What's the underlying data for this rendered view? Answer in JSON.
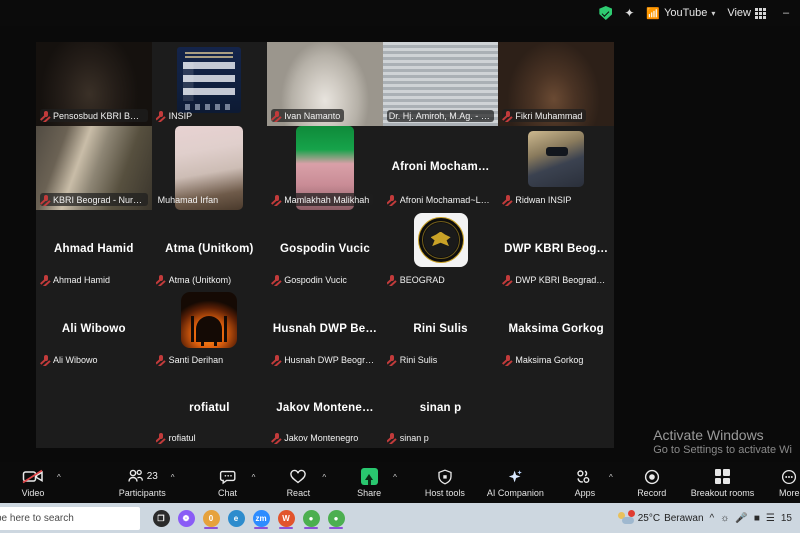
{
  "topbar": {
    "security_icon": "shield-check-icon",
    "sparkle_icon": "sparkle-icon",
    "youtube_icon": "broadcast-icon",
    "youtube_label": "YouTube",
    "chevron": "⌄",
    "view_label": "View",
    "view_icon": "grid-icon",
    "minimize_label": "–"
  },
  "gallery": {
    "rows": [
      {
        "tiles": [
          {
            "display_name": "",
            "label": "Pensosbud KBRI Beograd …",
            "muted": true,
            "kind": "video",
            "video": "v-pensos",
            "active": false
          },
          {
            "display_name": "",
            "label": "INSIP",
            "muted": true,
            "kind": "poster",
            "active": false
          },
          {
            "display_name": "",
            "label": "Ivan Namanto",
            "muted": true,
            "kind": "video",
            "video": "v-ivan",
            "active": false
          },
          {
            "display_name": "",
            "label": "Dr. Hj. Amiroh, M.Ag. - Rektor IN…",
            "muted": false,
            "kind": "video",
            "video": "v-amiroh",
            "active": true
          },
          {
            "display_name": "",
            "label": "Fikri Muhammad",
            "muted": true,
            "kind": "video",
            "video": "v-fikri",
            "active": false
          }
        ]
      },
      {
        "tiles": [
          {
            "display_name": "",
            "label": "KBRI Beograd - Nurus Syamsi",
            "muted": true,
            "kind": "video",
            "video": "v-kbri",
            "active": false
          },
          {
            "display_name": "",
            "label": "Muhamad Irfan",
            "muted": false,
            "kind": "inset-photo",
            "active": false
          },
          {
            "display_name": "",
            "label": "Mamlakhah Malikhah",
            "muted": true,
            "kind": "inset-video",
            "active": false
          },
          {
            "display_name": "Afroni  Mocham…",
            "label": "Afroni Mochamad~LPPM INSIP",
            "muted": true,
            "kind": "name",
            "active": false
          },
          {
            "display_name": "",
            "label": "Ridwan INSIP",
            "muted": true,
            "kind": "inset-avatar",
            "active": false
          }
        ]
      },
      {
        "tiles": [
          {
            "display_name": "Ahmad Hamid",
            "label": "Ahmad Hamid",
            "muted": true,
            "kind": "name",
            "active": false
          },
          {
            "display_name": "Atma (Unitkom)",
            "label": "Atma (Unitkom)",
            "muted": true,
            "kind": "name",
            "active": false
          },
          {
            "display_name": "Gospodin Vucic",
            "label": "Gospodin Vucic",
            "muted": true,
            "kind": "name",
            "active": false
          },
          {
            "display_name": "",
            "label": "BEOGRAD",
            "muted": true,
            "kind": "logo",
            "active": false
          },
          {
            "display_name": "DWP KBRI Beog…",
            "label": "DWP KBRI Beograd-Anggi Wd",
            "muted": true,
            "kind": "name",
            "active": false
          }
        ]
      },
      {
        "tiles": [
          {
            "display_name": "Ali Wibowo",
            "label": "Ali Wibowo",
            "muted": true,
            "kind": "name",
            "active": false
          },
          {
            "display_name": "",
            "label": "Santi Derihan",
            "muted": true,
            "kind": "mosque",
            "active": false
          },
          {
            "display_name": "Husnah  DWP Be…",
            "label": "Husnah DWP Beograd",
            "muted": true,
            "kind": "name",
            "active": false
          },
          {
            "display_name": "Rini Sulis",
            "label": "Rini Sulis",
            "muted": true,
            "kind": "name",
            "active": false
          },
          {
            "display_name": "Maksima Gorkog",
            "label": "Maksima Gorkog",
            "muted": true,
            "kind": "name",
            "active": false
          }
        ]
      },
      {
        "tiles": [
          {
            "display_name": "",
            "label": "",
            "muted": false,
            "kind": "empty",
            "active": false
          },
          {
            "display_name": "rofiatul",
            "label": "rofiatul",
            "muted": true,
            "kind": "name",
            "active": false
          },
          {
            "display_name": "Jakov  Montene…",
            "label": "Jakov Montenegro",
            "muted": true,
            "kind": "name",
            "active": false
          },
          {
            "display_name": "sinan p",
            "label": "sinan p",
            "muted": true,
            "kind": "name",
            "active": false
          },
          {
            "display_name": "",
            "label": "",
            "muted": false,
            "kind": "empty",
            "active": false
          }
        ]
      }
    ]
  },
  "watermark": {
    "line1": "Activate Windows",
    "line2": "Go to Settings to activate Wi"
  },
  "toolbar": {
    "video": {
      "label": "Video",
      "icon": "video-off-icon",
      "has_arrow": true
    },
    "participants": {
      "label": "Participants",
      "icon": "participants-icon",
      "count": "23",
      "has_arrow": true
    },
    "chat": {
      "label": "Chat",
      "icon": "chat-icon",
      "has_arrow": true
    },
    "react": {
      "label": "React",
      "icon": "heart-icon",
      "has_arrow": true
    },
    "share": {
      "label": "Share",
      "icon": "share-screen-icon",
      "has_arrow": true
    },
    "host_tools": {
      "label": "Host tools",
      "icon": "shield-icon",
      "has_arrow": false
    },
    "ai_companion": {
      "label": "AI Companion",
      "icon": "sparkle-icon",
      "has_arrow": false
    },
    "apps": {
      "label": "Apps",
      "icon": "apps-icon",
      "has_arrow": true
    },
    "record": {
      "label": "Record",
      "icon": "record-icon",
      "has_arrow": false
    },
    "breakout": {
      "label": "Breakout rooms",
      "icon": "breakout-rooms-icon",
      "has_arrow": false
    },
    "more": {
      "label": "More",
      "icon": "more-ellipsis-icon",
      "has_arrow": false
    }
  },
  "taskbar": {
    "search_placeholder": "pe here to search",
    "weather_temp": "25°C",
    "weather_desc": "Berawan",
    "time_partial": "15",
    "apps": [
      {
        "name": "task-view-icon",
        "glyph": "❐",
        "color": "#2b2b2b",
        "underline": ""
      },
      {
        "name": "copilot-icon",
        "glyph": "❁",
        "color": "#8a5cf6",
        "underline": ""
      },
      {
        "name": "file-explorer-icon",
        "glyph": "὜0",
        "color": "#e6a23c",
        "underline": "#8c52d6"
      },
      {
        "name": "edge-icon",
        "glyph": "e",
        "color": "#2d8ccd",
        "underline": ""
      },
      {
        "name": "zoom-icon",
        "glyph": "zm",
        "color": "#2d8cff",
        "underline": "#8c52d6"
      },
      {
        "name": "wps-office-icon",
        "glyph": "W",
        "color": "#e2542c",
        "underline": "#8c52d6"
      },
      {
        "name": "chrome-icon",
        "glyph": "●",
        "color": "#4caf50",
        "underline": "#8c52d6"
      },
      {
        "name": "chrome-profile-icon",
        "glyph": "●",
        "color": "#4caf50",
        "underline": "#8c52d6"
      }
    ]
  }
}
